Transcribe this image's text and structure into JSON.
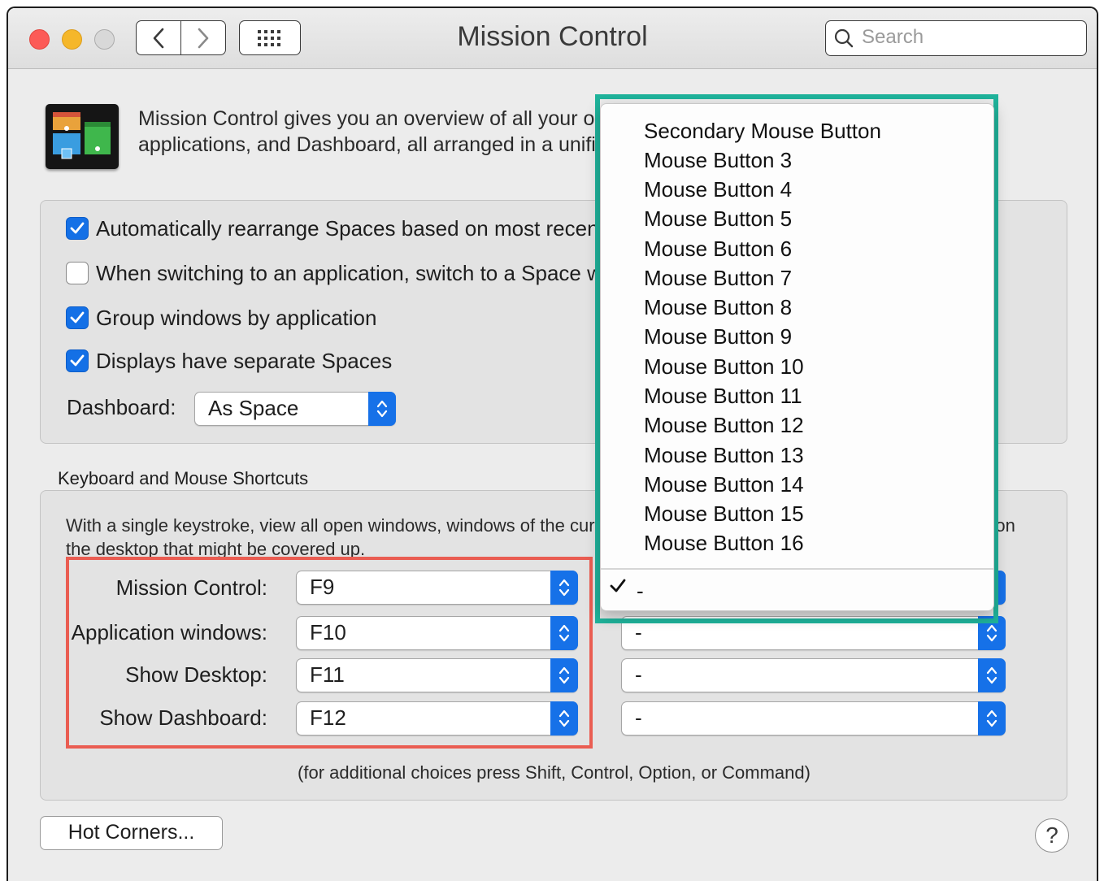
{
  "window": {
    "title": "Mission Control",
    "search_placeholder": "Search"
  },
  "description": "Mission Control gives you an overview of all your open windows, thumbnails of your full-screen applications, and Dashboard, all arranged in a unified view.",
  "options": [
    {
      "label": "Automatically rearrange Spaces based on most recent use",
      "checked": true
    },
    {
      "label": "When switching to an application, switch to a Space with open windows for the application",
      "checked": false
    },
    {
      "label": "Group windows by application",
      "checked": true
    },
    {
      "label": "Displays have separate Spaces",
      "checked": true
    }
  ],
  "dashboard": {
    "label": "Dashboard:",
    "value": "As Space"
  },
  "shortcuts": {
    "section_title": "Keyboard and Mouse Shortcuts",
    "description": "With a single keystroke, view all open windows, windows of the current application, or hide windows to locate an item on the desktop that might be covered up.",
    "rows": [
      {
        "label": "Mission Control:",
        "keyboard": "F9",
        "mouse": "-"
      },
      {
        "label": "Application windows:",
        "keyboard": "F10",
        "mouse": "-"
      },
      {
        "label": "Show Desktop:",
        "keyboard": "F11",
        "mouse": "-"
      },
      {
        "label": "Show Dashboard:",
        "keyboard": "F12",
        "mouse": "-"
      }
    ],
    "footnote": "(for additional choices press Shift, Control, Option, or Command)"
  },
  "mouse_menu": {
    "items": [
      "Secondary Mouse Button",
      "Mouse Button 3",
      "Mouse Button 4",
      "Mouse Button 5",
      "Mouse Button 6",
      "Mouse Button 7",
      "Mouse Button 8",
      "Mouse Button 9",
      "Mouse Button 10",
      "Mouse Button 11",
      "Mouse Button 12",
      "Mouse Button 13",
      "Mouse Button 14",
      "Mouse Button 15",
      "Mouse Button 16"
    ],
    "selected": "-"
  },
  "buttons": {
    "hot_corners": "Hot Corners...",
    "help": "?"
  },
  "colors": {
    "accent": "#1470e6",
    "annotation_red": "#ea5d52",
    "annotation_teal": "#1fb39b"
  },
  "icons": [
    "back-chevron-icon",
    "forward-chevron-icon",
    "grid-icon",
    "search-icon",
    "checkmark-icon",
    "up-down-chevron-icon",
    "mission-control-app-icon"
  ]
}
